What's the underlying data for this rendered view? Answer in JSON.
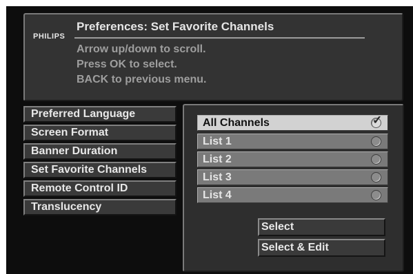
{
  "header": {
    "brand": "PHILIPS",
    "title": "Preferences: Set Favorite Channels",
    "instructions": [
      "Arrow up/down to scroll.",
      "Press OK to select.",
      "BACK to previous menu."
    ]
  },
  "menu": {
    "items": [
      {
        "label": "Preferred Language"
      },
      {
        "label": "Screen Format"
      },
      {
        "label": "Banner Duration"
      },
      {
        "label": "Set Favorite Channels"
      },
      {
        "label": "Remote Control ID"
      },
      {
        "label": "Translucency"
      }
    ]
  },
  "options": {
    "items": [
      {
        "label": "All Channels",
        "selected": true
      },
      {
        "label": "List 1",
        "selected": false
      },
      {
        "label": "List 2",
        "selected": false
      },
      {
        "label": "List 3",
        "selected": false
      },
      {
        "label": "List 4",
        "selected": false
      }
    ],
    "check_glyph": "✓"
  },
  "buttons": {
    "select": "Select",
    "select_edit": "Select & Edit"
  },
  "colors": {
    "screen_bg": "#0d0d0d",
    "panel_bg": "#333333",
    "highlight": "#d2d2d2"
  }
}
